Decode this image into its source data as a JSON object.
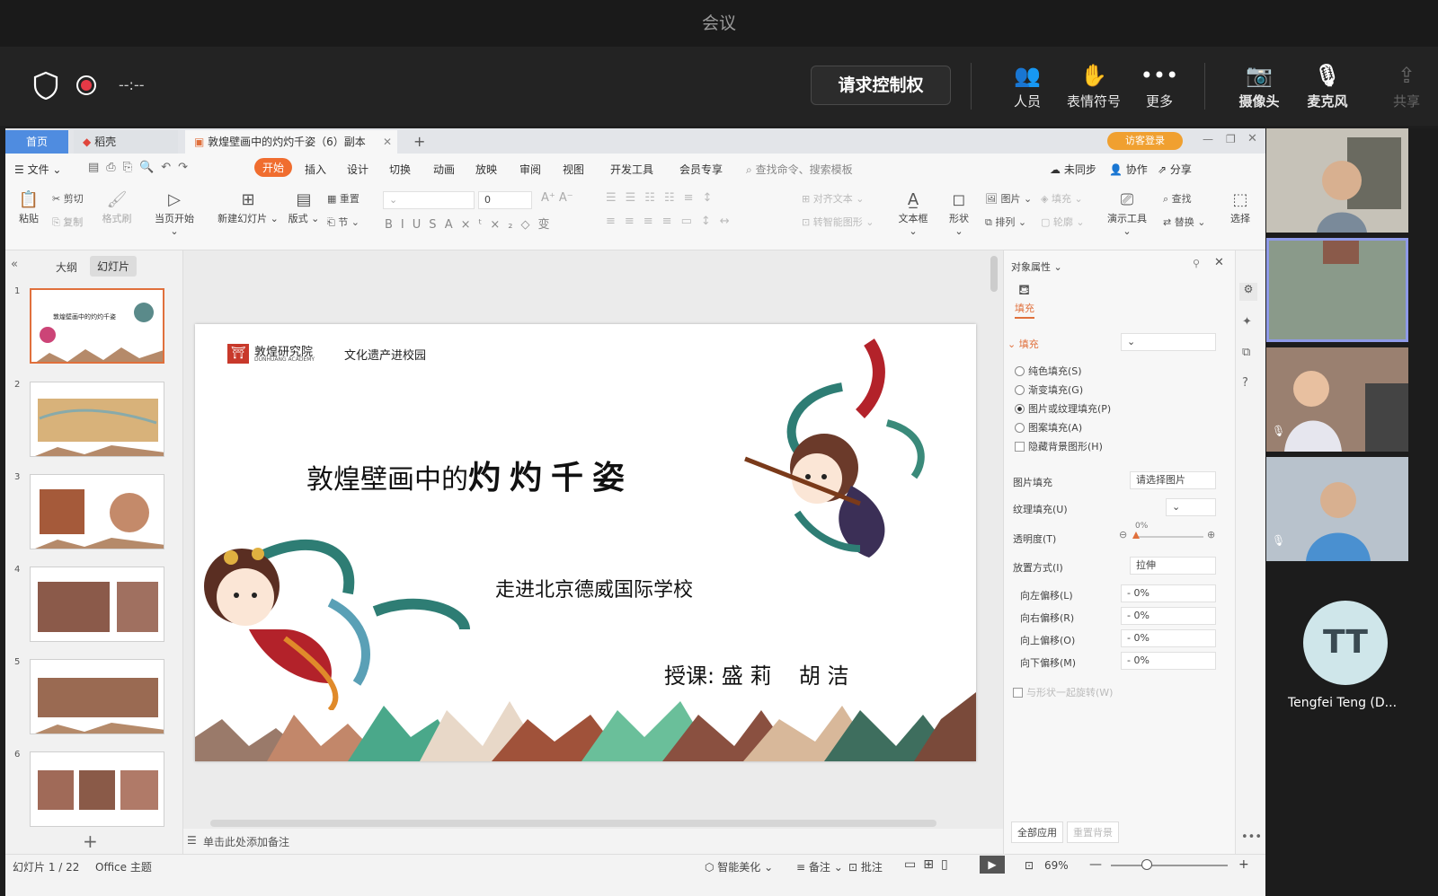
{
  "meeting": {
    "window_title": "会议",
    "timer": "--:--",
    "request_control": "请求控制权",
    "buttons": {
      "people": "人员",
      "emoji": "表情符号",
      "more": "更多",
      "camera": "摄像头",
      "mic": "麦克风",
      "share": "共享"
    }
  },
  "wps": {
    "tabs": {
      "home": "首页",
      "docer": "稻壳",
      "doc": "敦煌壁画中的灼灼千姿（6）副本"
    },
    "visitor_login": "访客登录",
    "menu": [
      "文件",
      "开始",
      "插入",
      "设计",
      "切换",
      "动画",
      "放映",
      "审阅",
      "视图",
      "开发工具",
      "会员专享"
    ],
    "search_placeholder": "查找命令、搜索模板",
    "right_menu": {
      "sync": "未同步",
      "collab": "协作",
      "share": "分享"
    },
    "ribbon": {
      "paste": "粘贴",
      "cut": "剪切",
      "copy": "复制",
      "format_painter": "格式刷",
      "start_current": "当页开始",
      "new_slide": "新建幻灯片",
      "layout": "版式",
      "reset": "重置",
      "section": "节",
      "font_size": "0",
      "align_text": "对齐文本",
      "smart_shape": "转智能图形",
      "textbox": "文本框",
      "shape": "形状",
      "picture": "图片",
      "fill": "填充",
      "arrange": "排列",
      "outline": "轮廓",
      "presenter": "演示工具",
      "find": "查找",
      "replace": "替换",
      "select": "选择"
    },
    "left_tabs": {
      "outline": "大纲",
      "slides": "幻灯片"
    },
    "slide_numbers": [
      "1",
      "2",
      "3",
      "4",
      "5",
      "6"
    ],
    "slide": {
      "logo_cn": "敦煌研究院",
      "logo_en": "DUNHUANG ACADEMY",
      "logo_slogan": "文化遗产进校园",
      "title_normal": "敦煌壁画中的",
      "title_bold": "灼灼千姿",
      "subtitle": "走进北京德威国际学校",
      "teachers_label": "授课:",
      "teacher1": "盛 莉",
      "teacher2": "胡 洁"
    },
    "notes_placeholder": "单击此处添加备注",
    "props": {
      "title": "对象属性",
      "fill_tab": "填充",
      "fill_section": "填充",
      "options": [
        "纯色填充(S)",
        "渐变填充(G)",
        "图片或纹理填充(P)",
        "图案填充(A)"
      ],
      "hide_bg": "隐藏背景图形(H)",
      "pic_fill": "图片填充",
      "pic_fill_value": "请选择图片",
      "texture_fill": "纹理填充(U)",
      "transparency": "透明度(T)",
      "transparency_value": "0%",
      "placement": "放置方式(I)",
      "placement_value": "拉伸",
      "offset_left": "向左偏移(L)",
      "offset_right": "向右偏移(R)",
      "offset_up": "向上偏移(O)",
      "offset_down": "向下偏移(M)",
      "offset_value": "0%",
      "rotate_with_shape": "与形状一起旋转(W)",
      "apply_all": "全部应用",
      "reset_bg": "重置背景"
    },
    "status": {
      "slide_info": "幻灯片 1 / 22",
      "theme": "Office 主题",
      "beautify": "智能美化",
      "notes": "备注",
      "comment": "批注",
      "zoom": "69%"
    }
  },
  "participants": {
    "avatar_initials": "TT",
    "name": "Tengfei Teng (D..."
  },
  "colors": {
    "accent_orange": "#e0703c",
    "wps_tab_blue": "#4f8ce0",
    "start_btn": "#f06d2f",
    "active_tile": "#8e9ae8"
  }
}
